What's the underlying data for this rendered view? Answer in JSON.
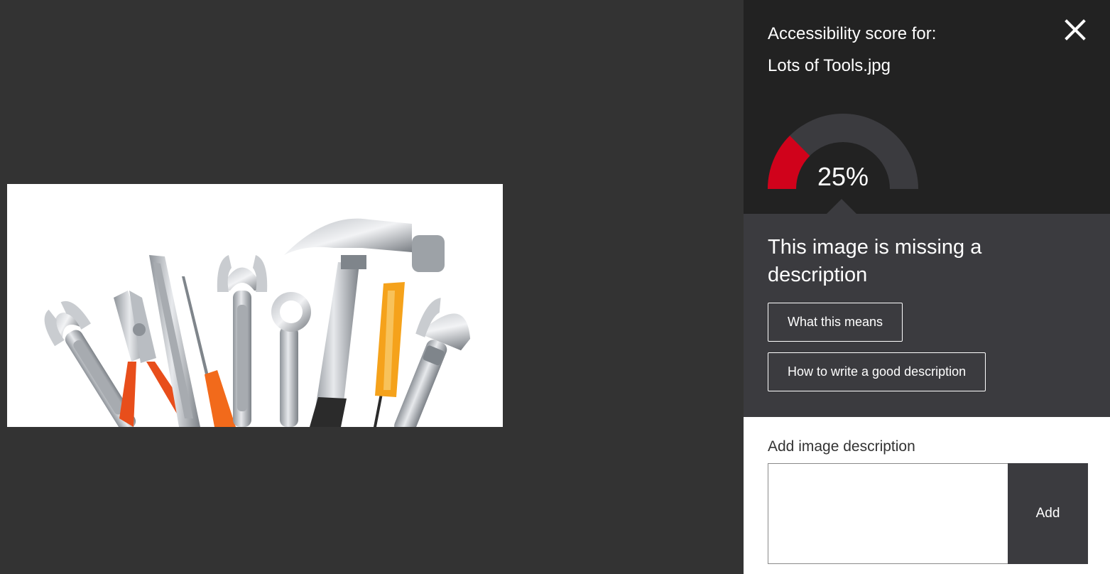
{
  "panel": {
    "header_label": "Accessibility score for:",
    "filename": "Lots of Tools.jpg",
    "close_icon": "close-icon"
  },
  "score": {
    "display": "25%",
    "value": 25,
    "fill_color": "#d0021b",
    "track_color": "#3b3b3f"
  },
  "status": {
    "title": "This image is missing a description"
  },
  "buttons": {
    "what_means": "What this means",
    "how_to": "How to write a good description"
  },
  "description": {
    "label": "Add image description",
    "value": "",
    "add_label": "Add"
  },
  "image": {
    "subject": "tools-photo"
  }
}
